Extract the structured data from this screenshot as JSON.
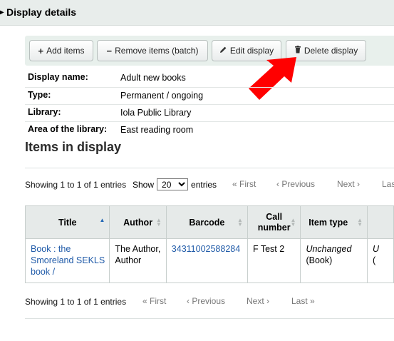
{
  "header": {
    "title": "Display details"
  },
  "toolbar": {
    "add_label": "Add items",
    "remove_label": "Remove items (batch)",
    "edit_label": "Edit display",
    "delete_label": "Delete display"
  },
  "details": [
    {
      "label": "Display name:",
      "value": "Adult new books"
    },
    {
      "label": "Type:",
      "value": "Permanent / ongoing"
    },
    {
      "label": "Library:",
      "value": "Iola Public Library"
    },
    {
      "label": "Area of the library:",
      "value": "East reading room"
    }
  ],
  "items_section": {
    "title": "Items in display",
    "info_text": "Showing 1 to 1 of 1 entries",
    "length": {
      "show": "Show",
      "selected": "20",
      "entries": "entries"
    },
    "pagination": {
      "first": "« First",
      "previous": "‹ Previous",
      "next": "Next ›",
      "last": "Last »"
    },
    "columns": [
      "Title",
      "Author",
      "Barcode",
      "Call number",
      "Item type"
    ],
    "rows": [
      {
        "title": "Book : the Smoreland SEKLS book /",
        "author": "The Author, Author",
        "barcode": "34311002588284",
        "call_number": "F Test 2",
        "item_type_status": "Unchanged",
        "item_type": "(Book)",
        "next_col_status": "U",
        "next_col": "("
      }
    ]
  },
  "colors": {
    "link": "#1f5aa8",
    "arrow": "#ff0000",
    "sort_active": "#1f66b5"
  }
}
